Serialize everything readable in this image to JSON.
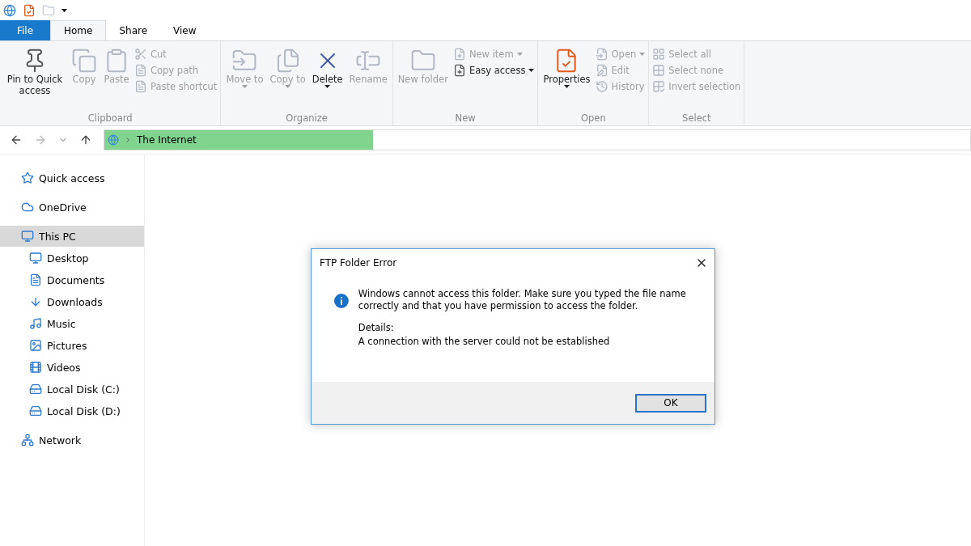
{
  "ribbon_tabs": [
    {
      "label": "File",
      "kind": "file",
      "selected": false
    },
    {
      "label": "Home",
      "kind": "tab",
      "selected": true
    },
    {
      "label": "Share",
      "kind": "tab",
      "selected": false
    },
    {
      "label": "View",
      "kind": "tab",
      "selected": false
    }
  ],
  "ribbon_groups": [
    {
      "label": "Clipboard",
      "items": [
        {
          "label": "Pin to Quick access",
          "kind": "large",
          "disabled": false,
          "dropdown": false
        },
        {
          "label": "Copy",
          "kind": "large",
          "disabled": true,
          "dropdown": false
        },
        {
          "label": "Paste",
          "kind": "large",
          "disabled": true,
          "dropdown": false
        },
        {
          "label": "Cut",
          "kind": "small",
          "disabled": true,
          "dropdown": false
        },
        {
          "label": "Copy path",
          "kind": "small",
          "disabled": true,
          "dropdown": false
        },
        {
          "label": "Paste shortcut",
          "kind": "small",
          "disabled": true,
          "dropdown": false
        }
      ]
    },
    {
      "label": "Organize",
      "items": [
        {
          "label": "Move to",
          "kind": "large",
          "disabled": true,
          "dropdown": true
        },
        {
          "label": "Copy to",
          "kind": "large",
          "disabled": true,
          "dropdown": true
        },
        {
          "label": "Delete",
          "kind": "large",
          "disabled": false,
          "dropdown": true
        },
        {
          "label": "Rename",
          "kind": "large",
          "disabled": true,
          "dropdown": false
        }
      ]
    },
    {
      "label": "New",
      "items": [
        {
          "label": "New folder",
          "kind": "large",
          "disabled": true,
          "dropdown": false
        },
        {
          "label": "New item",
          "kind": "small",
          "disabled": true,
          "dropdown": true
        },
        {
          "label": "Easy access",
          "kind": "small",
          "disabled": false,
          "dropdown": true
        }
      ]
    },
    {
      "label": "Open",
      "items": [
        {
          "label": "Properties",
          "kind": "large",
          "disabled": false,
          "dropdown": true
        },
        {
          "label": "Open",
          "kind": "small",
          "disabled": true,
          "dropdown": true
        },
        {
          "label": "Edit",
          "kind": "small",
          "disabled": true,
          "dropdown": false
        },
        {
          "label": "History",
          "kind": "small",
          "disabled": true,
          "dropdown": false
        }
      ]
    },
    {
      "label": "Select",
      "items": [
        {
          "label": "Select all",
          "kind": "small",
          "disabled": true,
          "dropdown": false
        },
        {
          "label": "Select none",
          "kind": "small",
          "disabled": true,
          "dropdown": false
        },
        {
          "label": "Invert selection",
          "kind": "small",
          "disabled": true,
          "dropdown": false
        }
      ]
    }
  ],
  "address_bar": {
    "path": "The Internet",
    "level": 0.31
  },
  "sidebar": {
    "items": [
      {
        "label": "Quick access",
        "selected": false
      },
      {
        "label": "OneDrive",
        "selected": false
      },
      {
        "label": "This PC",
        "selected": true,
        "children": [
          {
            "label": "Desktop",
            "selected": false
          },
          {
            "label": "Documents",
            "selected": false
          },
          {
            "label": "Downloads",
            "selected": false
          },
          {
            "label": "Music",
            "selected": false
          },
          {
            "label": "Pictures",
            "selected": false
          },
          {
            "label": "Videos",
            "selected": false
          },
          {
            "label": "Local Disk (C:)",
            "selected": false
          },
          {
            "label": "Local Disk (D:)",
            "selected": false
          }
        ]
      },
      {
        "label": "Network",
        "selected": false
      }
    ]
  },
  "dialog": {
    "title": "FTP Folder Error",
    "message": "Windows cannot access this folder. Make sure you typed the file name correctly and that you have permission to access the folder.",
    "details_label": "Details:",
    "details": "A connection with the server could not be established",
    "buttons": [
      "OK"
    ]
  }
}
